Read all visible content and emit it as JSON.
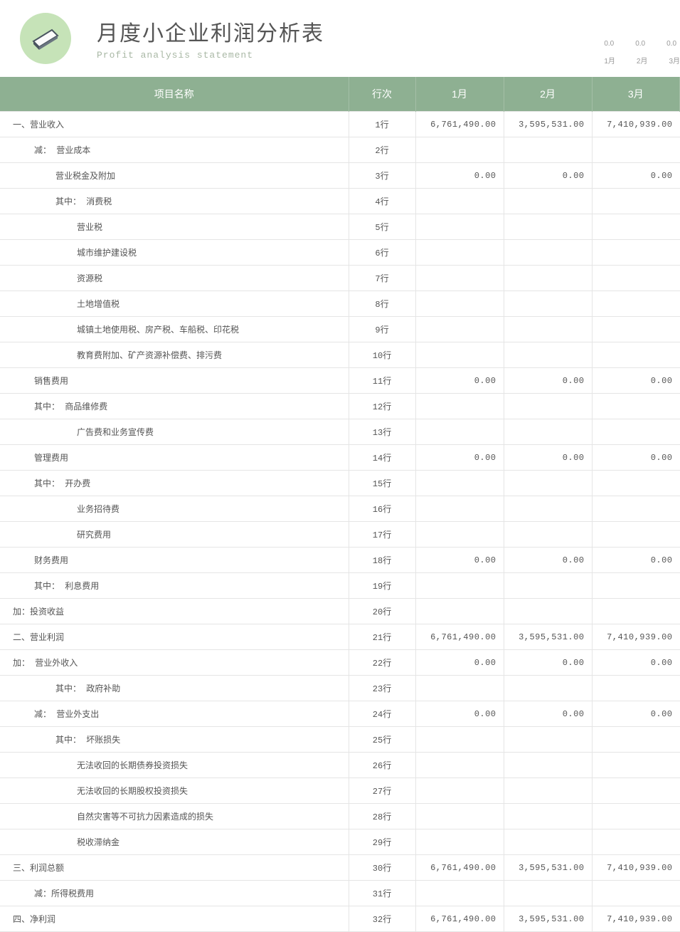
{
  "header": {
    "title": "月度小企业利润分析表",
    "subtitle": "Profit analysis statement"
  },
  "mini_chart": {
    "values": [
      "0.0",
      "0.0",
      "0.0"
    ],
    "labels": [
      "1月",
      "2月",
      "3月"
    ]
  },
  "table": {
    "headers": [
      "项目名称",
      "行次",
      "1月",
      "2月",
      "3月"
    ],
    "rows": [
      {
        "indent": 0,
        "name": "一、营业收入",
        "rownum": "1行",
        "m1": "6,761,490.00",
        "m2": "3,595,531.00",
        "m3": "7,410,939.00"
      },
      {
        "indent": 1,
        "name": "减： 营业成本",
        "rownum": "2行",
        "m1": "",
        "m2": "",
        "m3": ""
      },
      {
        "indent": 2,
        "name": "营业税金及附加",
        "rownum": "3行",
        "m1": "0.00",
        "m2": "0.00",
        "m3": "0.00"
      },
      {
        "indent": 2,
        "name": "其中： 消费税",
        "rownum": "4行",
        "m1": "",
        "m2": "",
        "m3": ""
      },
      {
        "indent": 3,
        "name": "营业税",
        "rownum": "5行",
        "m1": "",
        "m2": "",
        "m3": ""
      },
      {
        "indent": 3,
        "name": "城市维护建设税",
        "rownum": "6行",
        "m1": "",
        "m2": "",
        "m3": ""
      },
      {
        "indent": 3,
        "name": "资源税",
        "rownum": "7行",
        "m1": "",
        "m2": "",
        "m3": ""
      },
      {
        "indent": 3,
        "name": "土地增值税",
        "rownum": "8行",
        "m1": "",
        "m2": "",
        "m3": ""
      },
      {
        "indent": 3,
        "name": "城镇土地使用税、房产税、车船税、印花税",
        "rownum": "9行",
        "m1": "",
        "m2": "",
        "m3": ""
      },
      {
        "indent": 3,
        "name": "教育费附加、矿产资源补偿费、排污费",
        "rownum": "10行",
        "m1": "",
        "m2": "",
        "m3": ""
      },
      {
        "indent": 1,
        "name": "销售费用",
        "rownum": "11行",
        "m1": "0.00",
        "m2": "0.00",
        "m3": "0.00"
      },
      {
        "indent": 1,
        "name": "其中： 商品维修费",
        "rownum": "12行",
        "m1": "",
        "m2": "",
        "m3": ""
      },
      {
        "indent": 3,
        "name": "广告费和业务宣传费",
        "rownum": "13行",
        "m1": "",
        "m2": "",
        "m3": ""
      },
      {
        "indent": 1,
        "name": "管理费用",
        "rownum": "14行",
        "m1": "0.00",
        "m2": "0.00",
        "m3": "0.00"
      },
      {
        "indent": 1,
        "name": "其中： 开办费",
        "rownum": "15行",
        "m1": "",
        "m2": "",
        "m3": ""
      },
      {
        "indent": 3,
        "name": "业务招待费",
        "rownum": "16行",
        "m1": "",
        "m2": "",
        "m3": ""
      },
      {
        "indent": 3,
        "name": "研究费用",
        "rownum": "17行",
        "m1": "",
        "m2": "",
        "m3": ""
      },
      {
        "indent": 1,
        "name": "财务费用",
        "rownum": "18行",
        "m1": "0.00",
        "m2": "0.00",
        "m3": "0.00"
      },
      {
        "indent": 1,
        "name": "其中： 利息费用",
        "rownum": "19行",
        "m1": "",
        "m2": "",
        "m3": ""
      },
      {
        "indent": 0,
        "name": "加：投资收益",
        "rownum": "20行",
        "m1": "",
        "m2": "",
        "m3": ""
      },
      {
        "indent": 0,
        "name": "二、营业利润",
        "rownum": "21行",
        "m1": "6,761,490.00",
        "m2": "3,595,531.00",
        "m3": "7,410,939.00"
      },
      {
        "indent": 0,
        "name": "加： 营业外收入",
        "rownum": "22行",
        "m1": "0.00",
        "m2": "0.00",
        "m3": "0.00"
      },
      {
        "indent": 2,
        "name": "其中： 政府补助",
        "rownum": "23行",
        "m1": "",
        "m2": "",
        "m3": ""
      },
      {
        "indent": 1,
        "name": "减： 营业外支出",
        "rownum": "24行",
        "m1": "0.00",
        "m2": "0.00",
        "m3": "0.00"
      },
      {
        "indent": 2,
        "name": "其中： 坏账损失",
        "rownum": "25行",
        "m1": "",
        "m2": "",
        "m3": ""
      },
      {
        "indent": 3,
        "name": "无法收回的长期债券投资损失",
        "rownum": "26行",
        "m1": "",
        "m2": "",
        "m3": ""
      },
      {
        "indent": 3,
        "name": "无法收回的长期股权投资损失",
        "rownum": "27行",
        "m1": "",
        "m2": "",
        "m3": ""
      },
      {
        "indent": 3,
        "name": "自然灾害等不可抗力因素造成的损失",
        "rownum": "28行",
        "m1": "",
        "m2": "",
        "m3": ""
      },
      {
        "indent": 3,
        "name": "税收滞纳金",
        "rownum": "29行",
        "m1": "",
        "m2": "",
        "m3": ""
      },
      {
        "indent": 0,
        "name": "三、利润总额",
        "rownum": "30行",
        "m1": "6,761,490.00",
        "m2": "3,595,531.00",
        "m3": "7,410,939.00"
      },
      {
        "indent": 1,
        "name": "减：所得税费用",
        "rownum": "31行",
        "m1": "",
        "m2": "",
        "m3": ""
      },
      {
        "indent": 0,
        "name": "四、净利润",
        "rownum": "32行",
        "m1": "6,761,490.00",
        "m2": "3,595,531.00",
        "m3": "7,410,939.00"
      }
    ]
  }
}
